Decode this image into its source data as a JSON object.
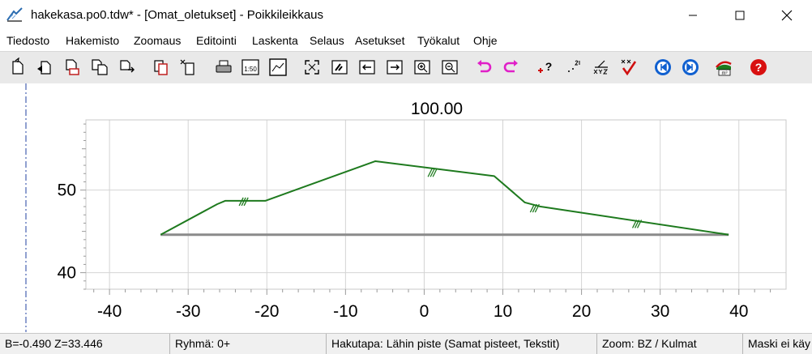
{
  "window": {
    "title": "hakekasa.po0.tdw* - [Omat_oletukset] - Poikkileikkaus",
    "controls": [
      "minimize",
      "maximize",
      "close"
    ]
  },
  "menu": {
    "items": [
      "Tiedosto",
      "Hakemisto",
      "Zoomaus",
      "Editointi",
      "Laskenta",
      "Selaus",
      "Asetukset",
      "Työkalut",
      "Ohje"
    ]
  },
  "toolbar": {
    "buttons": [
      {
        "name": "open-icon"
      },
      {
        "name": "open-previous-icon"
      },
      {
        "name": "save-icon"
      },
      {
        "name": "save-as-icon"
      },
      {
        "name": "export-icon"
      },
      {
        "name": "copy-icon"
      },
      {
        "name": "paste-icon"
      },
      {
        "name": "print-icon"
      },
      {
        "name": "scale-icon",
        "label": "1:50"
      },
      {
        "name": "print-preview-icon"
      },
      {
        "name": "zoom-fit-icon"
      },
      {
        "name": "zoom-area-icon"
      },
      {
        "name": "pan-left-icon"
      },
      {
        "name": "pan-right-icon"
      },
      {
        "name": "zoom-in-icon"
      },
      {
        "name": "zoom-out-icon"
      },
      {
        "name": "undo-icon"
      },
      {
        "name": "redo-icon"
      },
      {
        "name": "add-point-icon"
      },
      {
        "name": "point-numbers-icon"
      },
      {
        "name": "coordinates-icon"
      },
      {
        "name": "check-icon"
      },
      {
        "name": "previous-section-icon"
      },
      {
        "name": "next-section-icon"
      },
      {
        "name": "volume-icon"
      },
      {
        "name": "help-icon"
      }
    ],
    "colors": {
      "undo": "#e020c8",
      "nav": "#1060d0",
      "help": "#d81010"
    }
  },
  "chart_data": {
    "type": "line",
    "title": "100.00",
    "xlabel": "",
    "ylabel": "",
    "xlim": [
      -43,
      46
    ],
    "ylim": [
      38,
      58.5
    ],
    "x_ticks": [
      -40,
      -30,
      -20,
      -10,
      0,
      10,
      20,
      30,
      40
    ],
    "y_ticks": [
      40,
      50
    ],
    "grid": true,
    "series": [
      {
        "color": "#1e7a1e",
        "points": [
          [
            -33.5,
            44.6
          ],
          [
            -26.3,
            48.3
          ],
          [
            -25.3,
            48.7
          ],
          [
            -20.2,
            48.7
          ],
          [
            -6.2,
            53.5
          ],
          [
            8.9,
            51.7
          ],
          [
            12.8,
            48.5
          ],
          [
            14.8,
            48.0
          ],
          [
            38.7,
            44.6
          ]
        ]
      },
      {
        "color": "#8a8a8a",
        "points": [
          [
            -33.5,
            44.6
          ],
          [
            38.7,
            44.6
          ]
        ]
      }
    ],
    "slope_marks": [
      [
        -23.0,
        48.6
      ],
      [
        1.0,
        52.1
      ],
      [
        14.0,
        47.8
      ],
      [
        27.0,
        45.9
      ]
    ]
  },
  "status": {
    "coords": "B=-0.490  Z=33.446",
    "group": "Ryhmä: 0+",
    "search_mode": "Hakutapa: Lähin piste (Samat pisteet, Tekstit)",
    "zoom": "Zoom: BZ  /  Kulmat",
    "mask": "Maski ei käy"
  }
}
